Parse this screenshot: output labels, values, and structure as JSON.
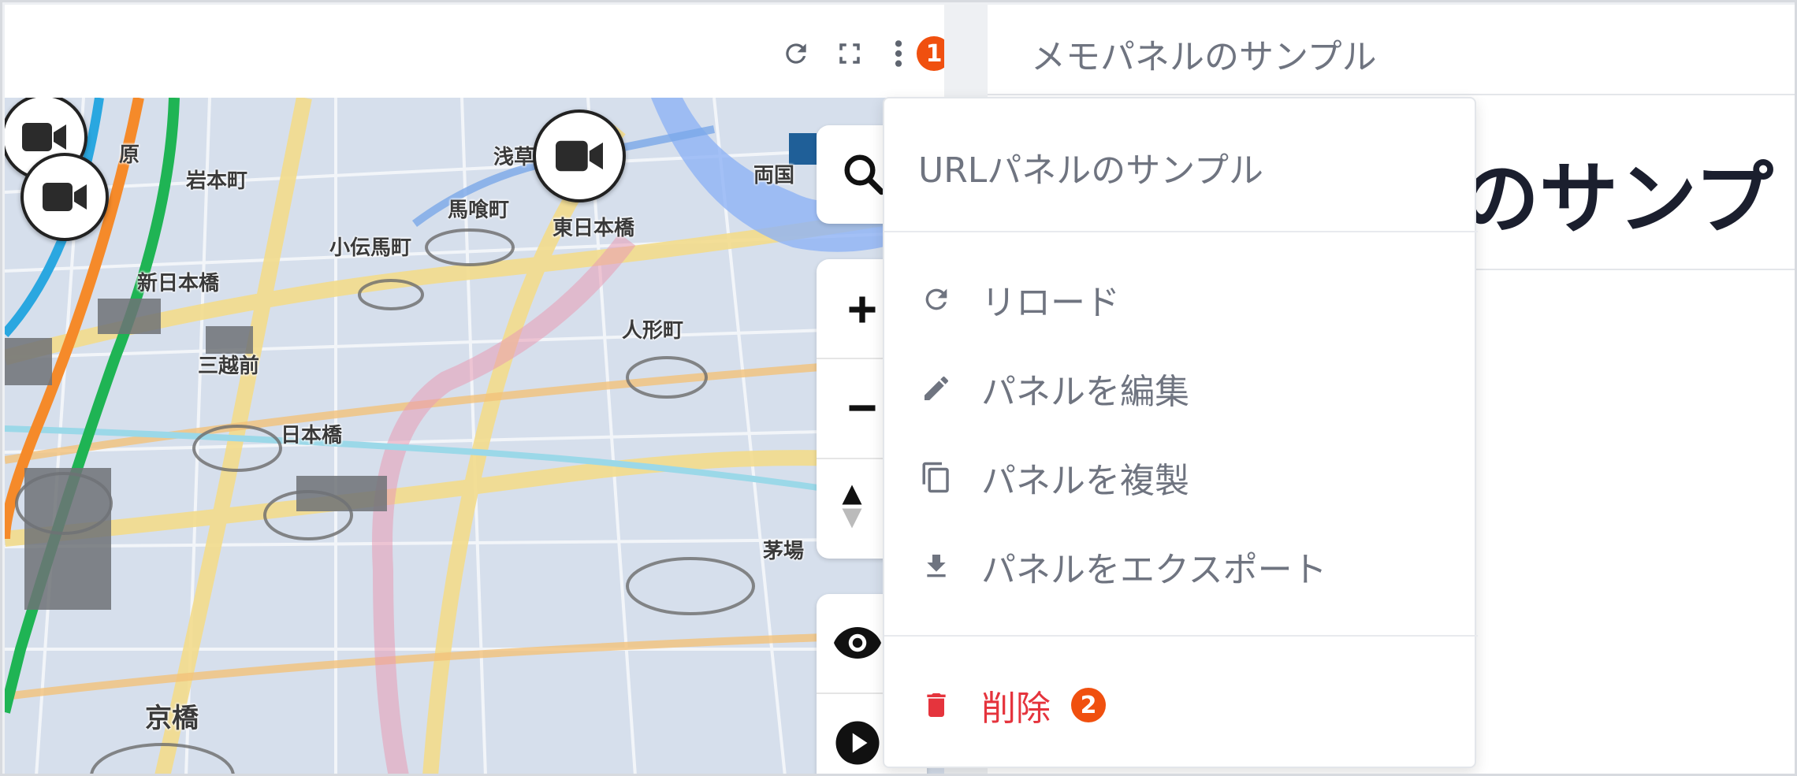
{
  "left_panel": {
    "toolbar": {
      "reload_icon": "reload-icon",
      "fullscreen_icon": "fullscreen-icon",
      "more_icon": "more-vertical-icon",
      "annotation": "1"
    },
    "map": {
      "labels": [
        {
          "text": "岩本町"
        },
        {
          "text": "浅草"
        },
        {
          "text": "両国"
        },
        {
          "text": "馬喰町"
        },
        {
          "text": "東日本橋"
        },
        {
          "text": "小伝馬町"
        },
        {
          "text": "新日本橋"
        },
        {
          "text": "人形町"
        },
        {
          "text": "三越前"
        },
        {
          "text": "日本橋"
        },
        {
          "text": "茅場"
        },
        {
          "text": "京橋"
        },
        {
          "text": "原"
        }
      ],
      "controls": {
        "search_icon": "search-icon",
        "zoom_in_icon": "plus-icon",
        "zoom_out_icon": "minus-icon",
        "compass_icon": "compass-icon",
        "visibility_icon": "eye-icon",
        "play_icon": "play-icon"
      },
      "camera_icon": "video-camera-icon"
    }
  },
  "right_panel": {
    "title": "メモパネルのサンプル",
    "content_heading": "のサンプ"
  },
  "menu": {
    "title": "URLパネルのサンプル",
    "items": [
      {
        "label": "リロード",
        "icon": "reload-icon"
      },
      {
        "label": "パネルを編集",
        "icon": "pencil-icon"
      },
      {
        "label": "パネルを複製",
        "icon": "copy-icon"
      },
      {
        "label": "パネルをエクスポート",
        "icon": "download-icon"
      }
    ],
    "delete": {
      "label": "削除",
      "icon": "trash-icon",
      "annotation": "2"
    }
  },
  "colors": {
    "accent_badge": "#f0500f",
    "danger": "#e5343d",
    "menu_text": "#6f7480"
  }
}
